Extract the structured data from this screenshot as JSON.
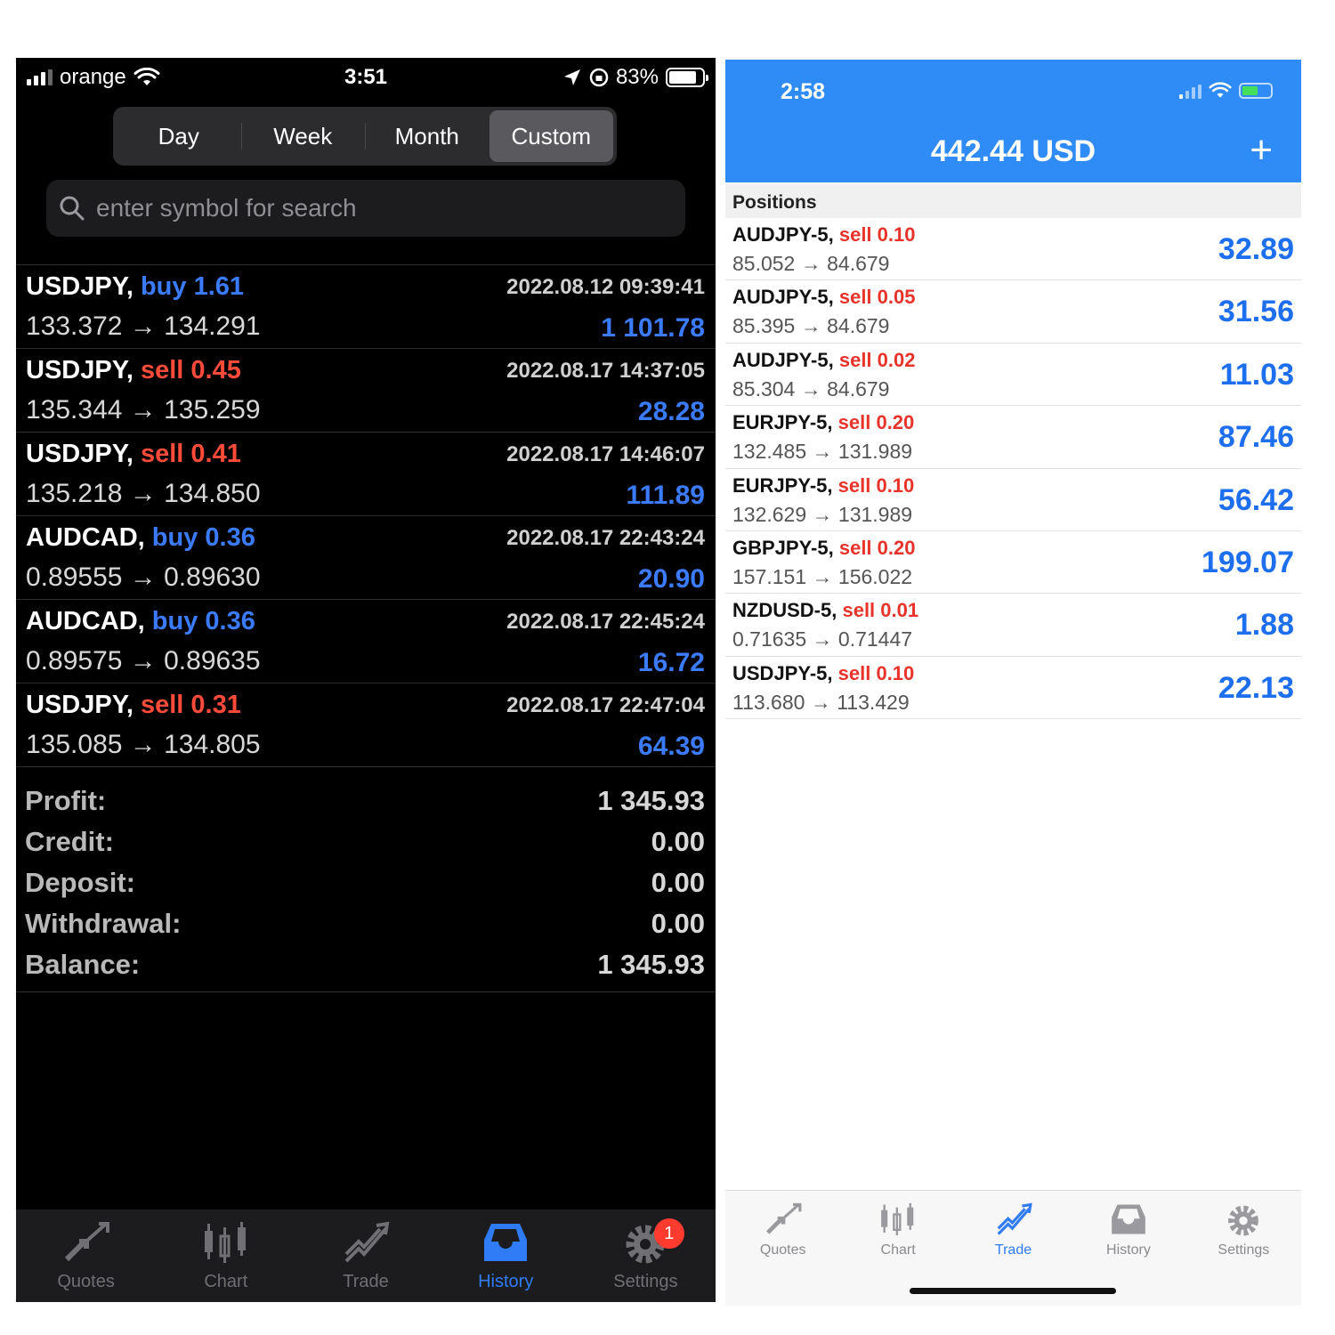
{
  "left": {
    "status": {
      "carrier": "orange",
      "time": "3:51",
      "battery": "83%"
    },
    "segments": [
      "Day",
      "Week",
      "Month",
      "Custom"
    ],
    "active_segment": "Custom",
    "search": {
      "placeholder": "enter symbol for search",
      "value": ""
    },
    "deals": [
      {
        "symbol": "USDJPY,",
        "side": "buy",
        "volume": "1.61",
        "datetime": "2022.08.12 09:39:41",
        "prices": "133.372 → 134.291",
        "profit": "1 101.78"
      },
      {
        "symbol": "USDJPY,",
        "side": "sell",
        "volume": "0.45",
        "datetime": "2022.08.17 14:37:05",
        "prices": "135.344 → 135.259",
        "profit": "28.28"
      },
      {
        "symbol": "USDJPY,",
        "side": "sell",
        "volume": "0.41",
        "datetime": "2022.08.17 14:46:07",
        "prices": "135.218 → 134.850",
        "profit": "111.89"
      },
      {
        "symbol": "AUDCAD,",
        "side": "buy",
        "volume": "0.36",
        "datetime": "2022.08.17 22:43:24",
        "prices": "0.89555 → 0.89630",
        "profit": "20.90"
      },
      {
        "symbol": "AUDCAD,",
        "side": "buy",
        "volume": "0.36",
        "datetime": "2022.08.17 22:45:24",
        "prices": "0.89575 → 0.89635",
        "profit": "16.72"
      },
      {
        "symbol": "USDJPY,",
        "side": "sell",
        "volume": "0.31",
        "datetime": "2022.08.17 22:47:04",
        "prices": "135.085 → 134.805",
        "profit": "64.39"
      }
    ],
    "summary": [
      {
        "label": "Profit:",
        "value": "1 345.93"
      },
      {
        "label": "Credit:",
        "value": "0.00"
      },
      {
        "label": "Deposit:",
        "value": "0.00"
      },
      {
        "label": "Withdrawal:",
        "value": "0.00"
      },
      {
        "label": "Balance:",
        "value": "1 345.93"
      }
    ],
    "tabs": [
      {
        "label": "Quotes",
        "icon": "quotes-arrows-icon"
      },
      {
        "label": "Chart",
        "icon": "candlestick-chart-icon"
      },
      {
        "label": "Trade",
        "icon": "trade-trend-icon"
      },
      {
        "label": "History",
        "icon": "history-tray-icon"
      },
      {
        "label": "Settings",
        "icon": "gear-icon"
      }
    ],
    "active_tab": "History",
    "settings_badge": "1"
  },
  "right": {
    "status": {
      "time": "2:58"
    },
    "balance": "442.44 USD",
    "positions_header": "Positions",
    "positions": [
      {
        "symbol": "AUDJPY-5,",
        "side": "sell",
        "volume": "0.10",
        "prices": "85.052 → 84.679",
        "profit": "32.89"
      },
      {
        "symbol": "AUDJPY-5,",
        "side": "sell",
        "volume": "0.05",
        "prices": "85.395 → 84.679",
        "profit": "31.56"
      },
      {
        "symbol": "AUDJPY-5,",
        "side": "sell",
        "volume": "0.02",
        "prices": "85.304 → 84.679",
        "profit": "11.03"
      },
      {
        "symbol": "EURJPY-5,",
        "side": "sell",
        "volume": "0.20",
        "prices": "132.485 → 131.989",
        "profit": "87.46"
      },
      {
        "symbol": "EURJPY-5,",
        "side": "sell",
        "volume": "0.10",
        "prices": "132.629 → 131.989",
        "profit": "56.42"
      },
      {
        "symbol": "GBPJPY-5,",
        "side": "sell",
        "volume": "0.20",
        "prices": "157.151 → 156.022",
        "profit": "199.07"
      },
      {
        "symbol": "NZDUSD-5,",
        "side": "sell",
        "volume": "0.01",
        "prices": "0.71635 → 0.71447",
        "profit": "1.88"
      },
      {
        "symbol": "USDJPY-5,",
        "side": "sell",
        "volume": "0.10",
        "prices": "113.680 → 113.429",
        "profit": "22.13"
      }
    ],
    "tabs": [
      {
        "label": "Quotes",
        "icon": "quotes-arrows-icon"
      },
      {
        "label": "Chart",
        "icon": "candlestick-chart-icon"
      },
      {
        "label": "Trade",
        "icon": "trade-trend-icon"
      },
      {
        "label": "History",
        "icon": "history-tray-icon"
      },
      {
        "label": "Settings",
        "icon": "gear-icon"
      }
    ],
    "active_tab": "Trade"
  },
  "colors": {
    "buy": "#3b7bff",
    "sell": "#ff4b3a",
    "accent": "#2f8cf6",
    "profit_light": "#1e6ff0"
  }
}
